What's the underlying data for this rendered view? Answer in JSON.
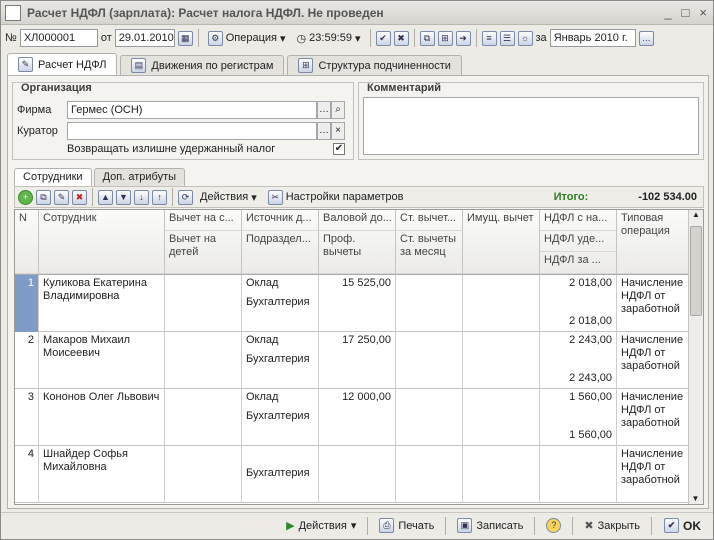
{
  "window": {
    "title": "Расчет НДФЛ (зарплата): Расчет налога НДФЛ. Не проведен",
    "controls": [
      "_",
      "□",
      "×"
    ]
  },
  "toolbar": {
    "num_label": "№",
    "number": "ХЛ000001",
    "from_label": "от",
    "date": "29.01.2010",
    "operation": "Операция",
    "time": "23:59:59",
    "period_label": "за",
    "period": "Январь 2010 г."
  },
  "tabs": [
    "Расчет НДФЛ",
    "Движения по регистрам",
    "Структура подчиненности"
  ],
  "org": {
    "title": "Организация",
    "firm_label": "Фирма",
    "firm": "Гермес (ОСН)",
    "curator_label": "Куратор",
    "curator": "",
    "refund_label": "Возвращать излишне удержанный налог",
    "refund_checked": true
  },
  "comment": {
    "title": "Комментарий",
    "text": ""
  },
  "subtabs": [
    "Сотрудники",
    "Доп. атрибуты"
  ],
  "gridbar": {
    "actions": "Действия",
    "settings": "Настройки параметров",
    "total_label": "Итого:",
    "total_value": "-102 534.00"
  },
  "headers": {
    "n": "N",
    "emp": "Сотрудник",
    "ded": "Вычет на с...",
    "ded_kids": "Вычет на детей",
    "src": "Источник д...",
    "dept": "Подраздел...",
    "gross": "Валовой до...",
    "prof": "Проф. вычеты",
    "std": "Ст. вычет...",
    "std_month": "Ст. вычеты за месяц",
    "prop": "Имущ. вычет",
    "ndfl1": "НДФЛ с на...",
    "ndfl2": "НДФЛ уде...",
    "ndfl3": "НДФЛ за ...",
    "op": "Типовая операция"
  },
  "rows": [
    {
      "n": "1",
      "emp": "Куликова Екатерина Владимировна",
      "src": "Оклад",
      "dept": "Бухгалтерия",
      "gross": "15 525,00",
      "ndfl1": "2 018,00",
      "ndfl3": "2 018,00",
      "op": "Начисление НДФЛ от заработной"
    },
    {
      "n": "2",
      "emp": "Макаров Михаил Моисеевич",
      "src": "Оклад",
      "dept": "Бухгалтерия",
      "gross": "17 250,00",
      "ndfl1": "2 243,00",
      "ndfl3": "2 243,00",
      "op": "Начисление НДФЛ от заработной"
    },
    {
      "n": "3",
      "emp": "Кононов Олег Львович",
      "src": "Оклад",
      "dept": "Бухгалтерия",
      "gross": "12 000,00",
      "ndfl1": "1 560,00",
      "ndfl3": "1 560,00",
      "op": "Начисление НДФЛ от заработной"
    },
    {
      "n": "4",
      "emp": "Шнайдер Софья Михайловна",
      "src": "",
      "dept": "Бухгалтерия",
      "gross": "",
      "ndfl1": "",
      "ndfl3": "",
      "op": "Начисление НДФЛ от заработной"
    }
  ],
  "bottom": {
    "actions": "Действия",
    "print": "Печать",
    "save": "Записать",
    "help": "?",
    "close": "Закрыть",
    "ok": "OK"
  }
}
